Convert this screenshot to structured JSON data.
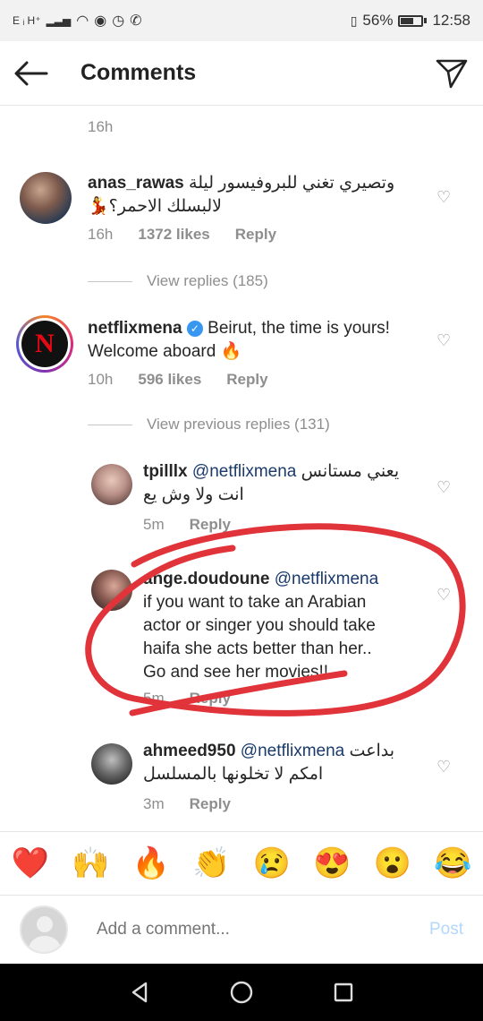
{
  "status_bar": {
    "network": "E ᵢ H⁺",
    "icons": [
      "wifi-icon",
      "eye-icon",
      "alarm-icon",
      "whatsapp-icon"
    ],
    "battery_pct": "56%",
    "time": "12:58"
  },
  "header": {
    "title": "Comments",
    "back_icon": "arrow-left-icon",
    "send_icon": "paper-plane-icon"
  },
  "comments": [
    {
      "time": "16h"
    },
    {
      "username": "anas_rawas",
      "text": "وتصيري تغني للبروفيسور ليلة",
      "text2": "لالبسلك الاحمر؟💃",
      "time": "16h",
      "likes": "1372 likes",
      "reply_label": "Reply",
      "view_replies": "View replies (185)"
    },
    {
      "username": "netflixmena",
      "text": "Beirut, the time is yours!",
      "text2": "Welcome aboard 🔥",
      "time": "10h",
      "likes": "596 likes",
      "reply_label": "Reply",
      "view_replies": "View previous replies (131)"
    }
  ],
  "replies": [
    {
      "username": "tpilllx",
      "mention": "@netflixmena",
      "text": "يعني مستانس",
      "text2": "انت ولا وش يع",
      "time": "5m",
      "reply_label": "Reply"
    },
    {
      "username": "ange.doudoune",
      "mention": "@netflixmena",
      "lines": [
        "if you want to take an Arabian",
        "actor or singer you should take",
        "haifa she acts better than her..",
        "Go and see her movies!!"
      ],
      "time": "5m",
      "reply_label": "Reply"
    },
    {
      "username": "ahmeed950",
      "mention": "@netflixmena",
      "text": "بداعت",
      "text2": "امكم لا تخلونها بالمسلسل",
      "time": "3m",
      "reply_label": "Reply"
    }
  ],
  "emoji_bar": [
    "❤️",
    "🙌",
    "🔥",
    "👏",
    "😢",
    "😍",
    "😮",
    "😂"
  ],
  "compose": {
    "placeholder": "Add a comment...",
    "post_label": "Post"
  },
  "colors": {
    "annotation_red": "#e0333a",
    "link_blue": "#3897f0"
  }
}
